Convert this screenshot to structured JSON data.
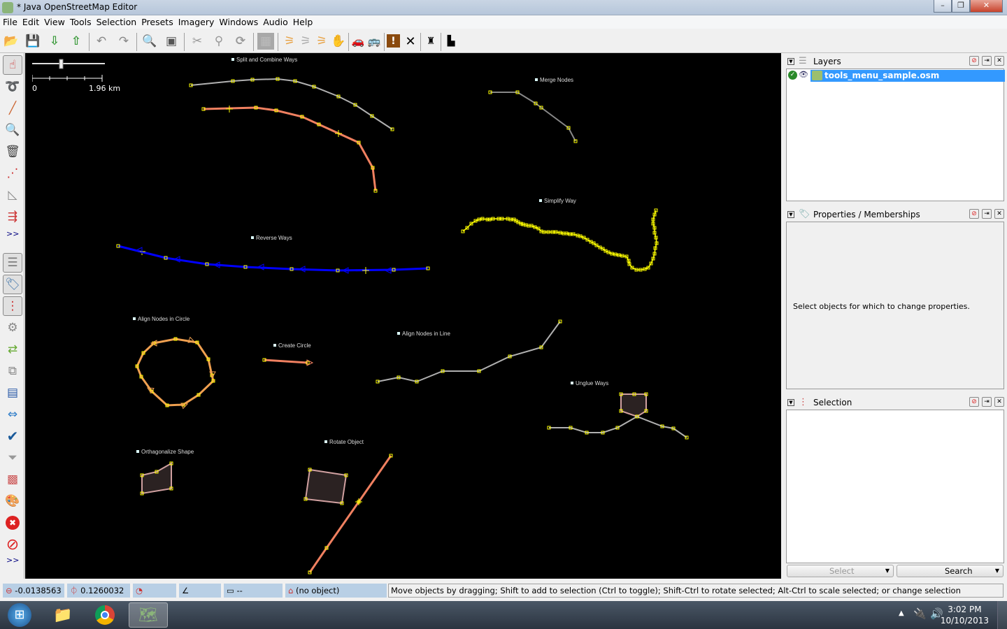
{
  "window": {
    "title": "* Java OpenStreetMap Editor",
    "controls": [
      "minimize",
      "maximize",
      "close"
    ]
  },
  "menu": [
    "File",
    "Edit",
    "View",
    "Tools",
    "Selection",
    "Presets",
    "Imagery",
    "Windows",
    "Audio",
    "Help"
  ],
  "toolbar": {
    "buttons": [
      {
        "icon": "open-file-icon",
        "glyph": "📂"
      },
      {
        "icon": "save-icon",
        "glyph": "💾"
      },
      {
        "icon": "download-icon",
        "glyph": "⇩"
      },
      {
        "icon": "upload-icon",
        "glyph": "⇧"
      },
      {
        "icon": "undo-icon",
        "glyph": "↶"
      },
      {
        "icon": "redo-icon",
        "glyph": "↷"
      },
      {
        "icon": "preferences-icon",
        "glyph": "🔍"
      },
      {
        "icon": "toggle-panel-icon",
        "glyph": "▣"
      },
      {
        "icon": "split-way-icon",
        "glyph": "✂"
      },
      {
        "icon": "combine-way-icon",
        "glyph": "⚲"
      },
      {
        "icon": "refresh-icon",
        "glyph": "⟳"
      },
      {
        "icon": "imagery-icon",
        "glyph": "▦"
      },
      {
        "icon": "road-icon",
        "glyph": "⚞"
      },
      {
        "icon": "road-gray-icon",
        "glyph": "⚞"
      },
      {
        "icon": "junction-icon",
        "glyph": "⚞"
      },
      {
        "icon": "hand-icon",
        "glyph": "✋"
      },
      {
        "icon": "car-icon",
        "glyph": "🚗"
      },
      {
        "icon": "bus-icon",
        "glyph": "🚌"
      },
      {
        "icon": "warning-icon",
        "glyph": "!"
      },
      {
        "icon": "restaurant-icon",
        "glyph": "✕"
      },
      {
        "icon": "castle-icon",
        "glyph": "♜"
      },
      {
        "icon": "factory-icon",
        "glyph": "▙"
      }
    ]
  },
  "left_tools": {
    "top": [
      {
        "icon": "select-mode-icon",
        "glyph": "☝",
        "active": true
      },
      {
        "icon": "lasso-icon",
        "glyph": "➰"
      },
      {
        "icon": "draw-icon",
        "glyph": "╱"
      },
      {
        "icon": "zoom-icon",
        "glyph": "🔍"
      },
      {
        "icon": "delete-icon",
        "glyph": "🗑"
      },
      {
        "icon": "parallel-icon",
        "glyph": "⋰"
      },
      {
        "icon": "measure-icon",
        "glyph": "◺"
      },
      {
        "icon": "improve-way-icon",
        "glyph": "⇶"
      }
    ],
    "more_label": ">>",
    "bottom": [
      {
        "icon": "layers-toggle-icon",
        "glyph": "☰",
        "active": true
      },
      {
        "icon": "properties-toggle-icon",
        "glyph": "🏷",
        "active": true
      },
      {
        "icon": "selection-toggle-icon",
        "glyph": "⋮",
        "active": true
      },
      {
        "icon": "commands-icon",
        "glyph": "⚙"
      },
      {
        "icon": "conflict-icon",
        "glyph": "⇄"
      },
      {
        "icon": "relations-icon",
        "glyph": "⧉"
      },
      {
        "icon": "history-icon",
        "glyph": "▤"
      },
      {
        "icon": "merge-icon",
        "glyph": "⇔"
      },
      {
        "icon": "validator-icon",
        "glyph": "✔"
      },
      {
        "icon": "filter-icon",
        "glyph": "⏷"
      },
      {
        "icon": "changeset-icon",
        "glyph": "▩"
      },
      {
        "icon": "map-paint-icon",
        "glyph": "🎨"
      },
      {
        "icon": "error-icon",
        "glyph": "✖"
      },
      {
        "icon": "no-entry-icon",
        "glyph": "⊘"
      }
    ],
    "more_label_bottom": ">>"
  },
  "map": {
    "scale_start": "0",
    "scale_end": "1.96 km",
    "labels": [
      {
        "text": "Split and Combine Ways"
      },
      {
        "text": "Merge Nodes"
      },
      {
        "text": "Simplify Way"
      },
      {
        "text": "Reverse Ways"
      },
      {
        "text": "Align Nodes in Circle"
      },
      {
        "text": "Create Circle"
      },
      {
        "text": "Align Nodes in Line"
      },
      {
        "text": "Unglue Ways"
      },
      {
        "text": "Orthagonalize Shape"
      },
      {
        "text": "Rotate Object"
      }
    ],
    "colors": {
      "background": "#000000",
      "untagged_way": "#b0b0b0",
      "highway": "#f08060",
      "reversed_way": "#0000ff",
      "simplify_way": "#ffff00",
      "circle_way": "#f0a050",
      "area_fill": "#2b2222",
      "area_stroke": "#d0a0a0",
      "node": "#ffff00"
    }
  },
  "layers_panel": {
    "title": "Layers",
    "layer_name": "tools_menu_sample.osm",
    "visible": true,
    "active": true
  },
  "properties_panel": {
    "title": "Properties / Memberships",
    "message": "Select objects for which to change properties."
  },
  "selection_panel": {
    "title": "Selection",
    "select_button": "Select",
    "search_button": "Search"
  },
  "status_bar": {
    "lat": "-0.0138563",
    "lon": "0.1260032",
    "heading": "",
    "angle": "",
    "distance": "--",
    "object": "(no object)",
    "message": "Move objects by dragging; Shift to add to selection (Ctrl to toggle); Shift-Ctrl to rotate selected; Alt-Ctrl to scale selected; or change selection"
  },
  "taskbar": {
    "apps": [
      {
        "icon": "windows-start-icon",
        "glyph": "⊞"
      },
      {
        "icon": "file-explorer-icon",
        "glyph": "📁"
      },
      {
        "icon": "chrome-icon",
        "glyph": "◉"
      },
      {
        "icon": "josm-icon",
        "glyph": "🗺",
        "active": true
      }
    ],
    "time": "3:02 PM",
    "date": "10/10/2013"
  }
}
